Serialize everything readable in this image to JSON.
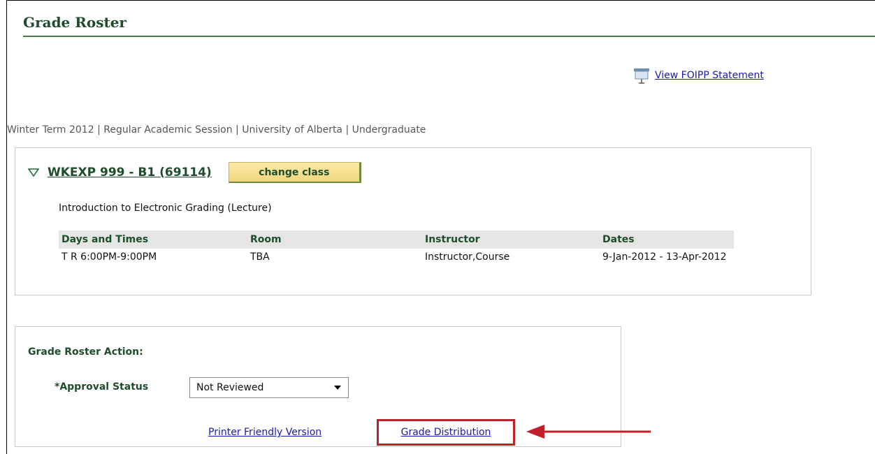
{
  "header": {
    "title": "Grade Roster"
  },
  "foipp": {
    "link_label": "View FOIPP Statement",
    "icon": "monitor-icon"
  },
  "term_info": "Winter Term 2012 | Regular Academic Session | University of Alberta | Undergraduate",
  "class_section": {
    "code": "WKEXP 999 - B1 (69114)",
    "change_button": "change class",
    "description": "Introduction to Electronic Grading (Lecture)",
    "schedule": {
      "headers": [
        "Days and Times",
        "Room",
        "Instructor",
        "Dates"
      ],
      "rows": [
        [
          "T R 6:00PM-9:00PM",
          "TBA",
          "Instructor,Course",
          "9-Jan-2012 - 13-Apr-2012"
        ]
      ]
    }
  },
  "action_panel": {
    "title": "Grade Roster Action:",
    "approval_label": "*Approval Status",
    "approval_value": "Not Reviewed",
    "printer_link": "Printer Friendly Version",
    "distribution_link": "Grade Distribution"
  },
  "colors": {
    "accent_green": "#1e4d2b",
    "link_blue": "#1a1ab0",
    "highlight_red": "#c0202a"
  }
}
